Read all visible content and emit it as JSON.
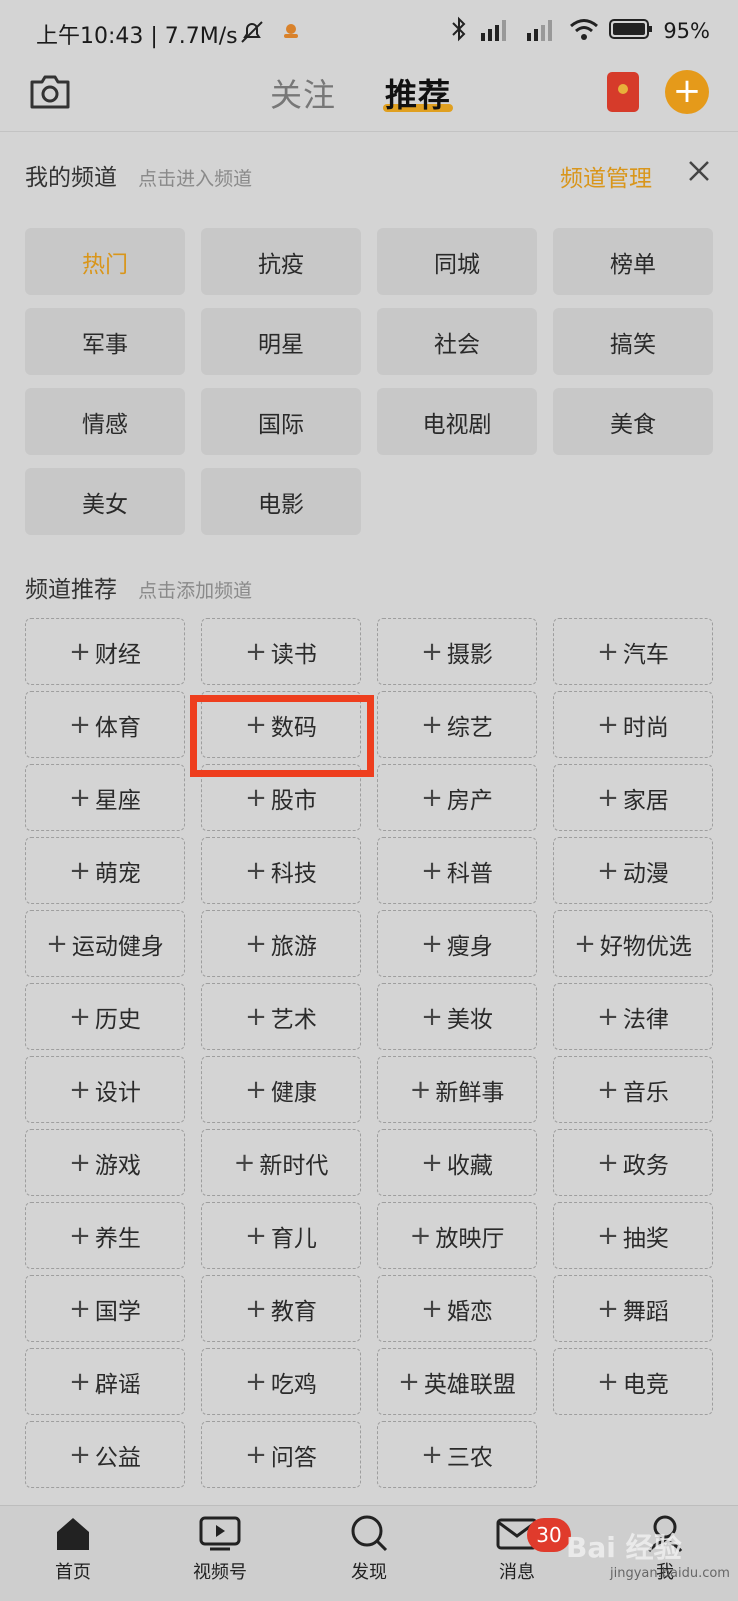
{
  "status": {
    "time": "上午10:43 | 7.7M/s",
    "battery": "95%"
  },
  "topnav": {
    "tab_follow": "关注",
    "tab_recommend": "推荐"
  },
  "my_channels": {
    "title": "我的频道",
    "hint": "点击进入频道",
    "manage": "频道管理",
    "items": [
      "热门",
      "抗疫",
      "同城",
      "榜单",
      "军事",
      "明星",
      "社会",
      "搞笑",
      "情感",
      "国际",
      "电视剧",
      "美食",
      "美女",
      "电影"
    ]
  },
  "recommended": {
    "title": "频道推荐",
    "hint": "点击添加频道",
    "plus": "+",
    "items": [
      "财经",
      "读书",
      "摄影",
      "汽车",
      "体育",
      "数码",
      "综艺",
      "时尚",
      "星座",
      "股市",
      "房产",
      "家居",
      "萌宠",
      "科技",
      "科普",
      "动漫",
      "运动健身",
      "旅游",
      "瘦身",
      "好物优选",
      "历史",
      "艺术",
      "美妆",
      "法律",
      "设计",
      "健康",
      "新鲜事",
      "音乐",
      "游戏",
      "新时代",
      "收藏",
      "政务",
      "养生",
      "育儿",
      "放映厅",
      "抽奖",
      "国学",
      "教育",
      "婚恋",
      "舞蹈",
      "辟谣",
      "吃鸡",
      "英雄联盟",
      "电竞",
      "公益",
      "问答",
      "三农"
    ]
  },
  "bottombar": {
    "home": "首页",
    "video": "视频号",
    "discover": "发现",
    "messages": "消息",
    "me": "我",
    "badge": "30"
  },
  "watermark": {
    "brand": "Bai 经验",
    "url": "jingyan.baidu.com"
  },
  "colors": {
    "accent": "#d9961b",
    "highlight": "#ee3e1e",
    "badge": "#e03b2c"
  }
}
